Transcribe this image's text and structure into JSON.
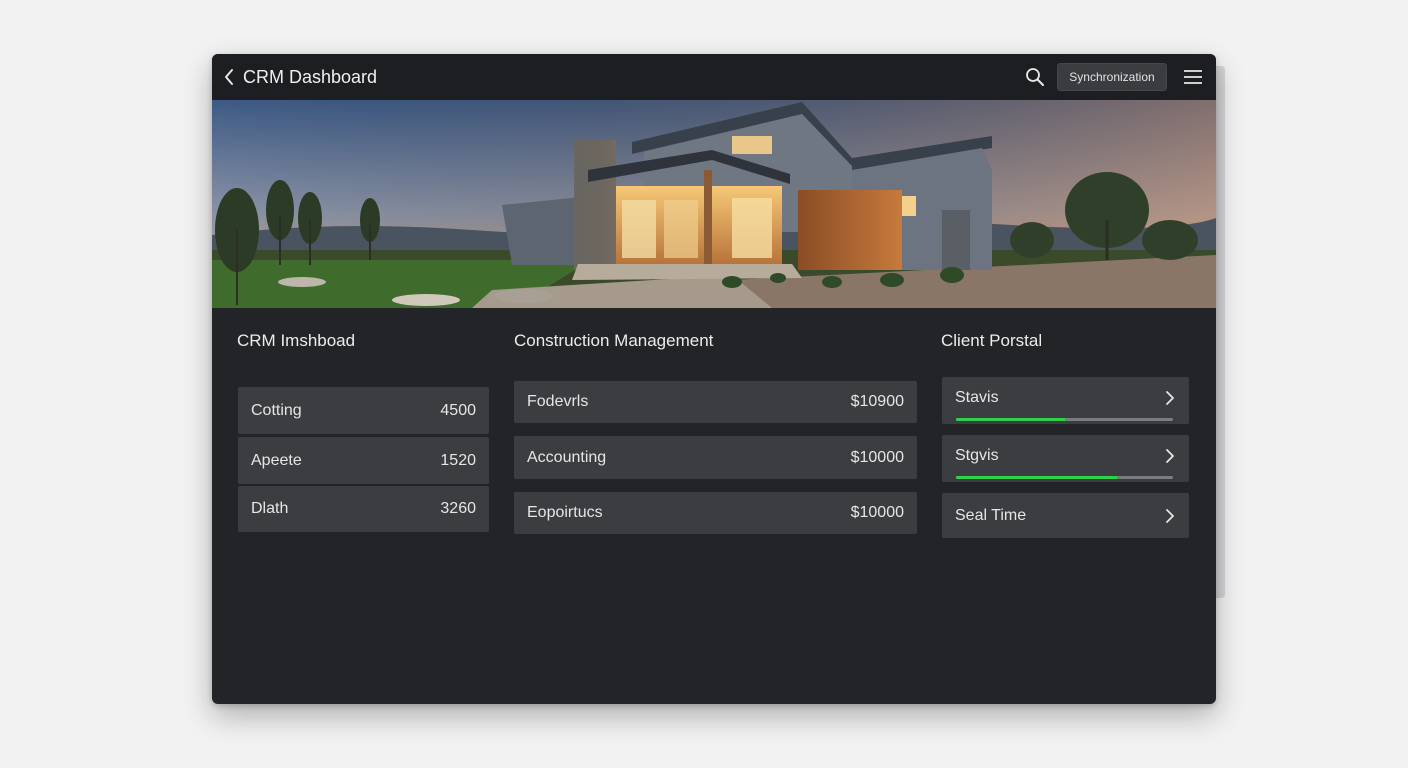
{
  "header": {
    "title": "CRM Dashboard",
    "sync_label": "Synchronization",
    "icons": [
      "back-chevron-icon",
      "search-icon",
      "hamburger-menu-icon"
    ]
  },
  "colors": {
    "window_bg": "#222428",
    "titlebar_bg": "#1c1e22",
    "row_bg": "#3b3d41",
    "progress_fill": "#2ed24a",
    "progress_track": "#7a7c80"
  },
  "columns": {
    "crm": {
      "title": "CRM Imshboad",
      "rows": [
        {
          "label": "Cotting",
          "value": "4500"
        },
        {
          "label": "Apeete",
          "value": "1520"
        },
        {
          "label": "Dlath",
          "value": "3260"
        }
      ]
    },
    "construction": {
      "title": "Construction Management",
      "rows": [
        {
          "label": "Fodevrls",
          "value": "$10900"
        },
        {
          "label": "Accounting",
          "value": "$10000"
        },
        {
          "label": "Eopoirtucs",
          "value": "$10000"
        }
      ]
    },
    "client": {
      "title": "Client Porstal",
      "rows": [
        {
          "label": "Stavis",
          "progress": 0.5
        },
        {
          "label": "Stgvis",
          "progress": 0.74
        },
        {
          "label": "Seal Time"
        }
      ]
    }
  }
}
